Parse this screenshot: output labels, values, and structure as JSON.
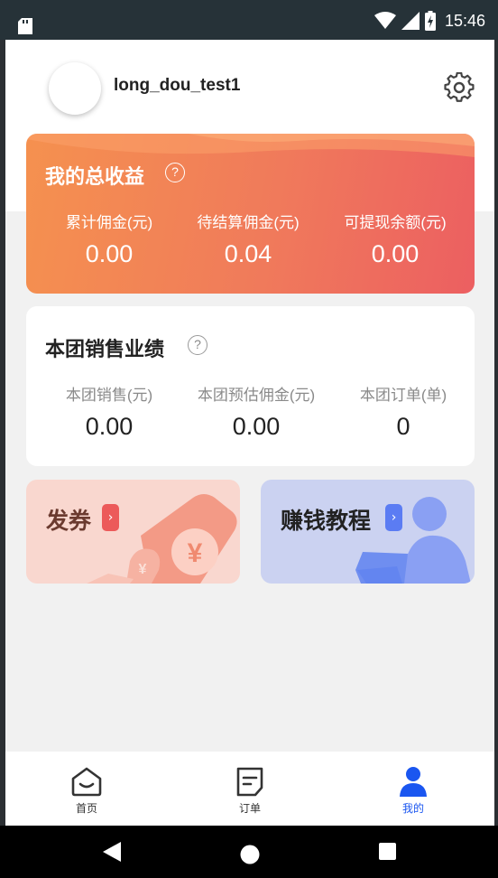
{
  "status_bar": {
    "time": "15:46"
  },
  "profile": {
    "username": "long_dou_test1"
  },
  "earnings_card": {
    "title": "我的总收益",
    "help": "?",
    "stats": [
      {
        "label": "累计佣金(元)",
        "value": "0.00"
      },
      {
        "label": "待结算佣金(元)",
        "value": "0.04"
      },
      {
        "label": "可提现余额(元)",
        "value": "0.00"
      }
    ]
  },
  "team_card": {
    "title": "本团销售业绩",
    "help": "?",
    "stats": [
      {
        "label": "本团销售(元)",
        "value": "0.00"
      },
      {
        "label": "本团预估佣金(元)",
        "value": "0.00"
      },
      {
        "label": "本团订单(单)",
        "value": "0"
      }
    ]
  },
  "tiles": {
    "coupon": {
      "label": "发券",
      "arrow": "›"
    },
    "tutorial": {
      "label": "赚钱教程",
      "arrow": "›"
    }
  },
  "tabbar": {
    "items": [
      {
        "label": "首页",
        "icon": "home-icon"
      },
      {
        "label": "订单",
        "icon": "orders-icon"
      },
      {
        "label": "我的",
        "icon": "profile-icon",
        "active": true
      }
    ],
    "active_color": "#1a56f0",
    "inactive_color": "#333333"
  },
  "colors": {
    "earnings_gradient_start": "#f5914f",
    "earnings_gradient_end": "#ec5f61",
    "coupon_bg": "#f9d7cf",
    "tutorial_bg": "#cbd2f1"
  }
}
